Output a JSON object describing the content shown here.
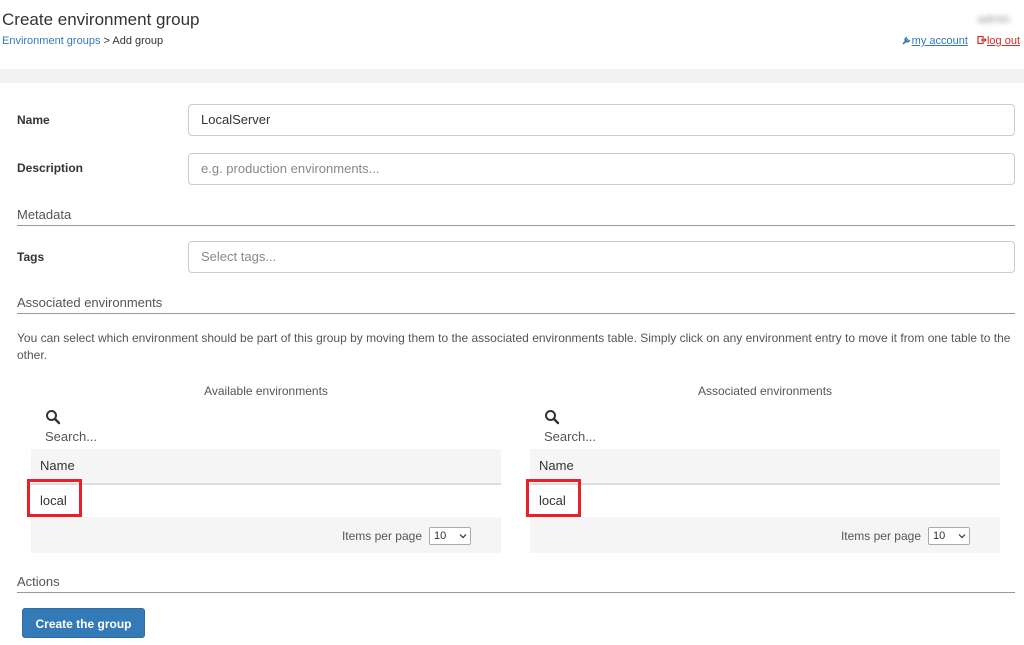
{
  "header": {
    "title": "Create environment group",
    "breadcrumb": {
      "parent": "Environment groups",
      "separator": " > ",
      "current": "Add group"
    },
    "user": {
      "name": "admin",
      "my_account": "my account",
      "log_out": "log out"
    }
  },
  "form": {
    "name": {
      "label": "Name",
      "value": "LocalServer"
    },
    "description": {
      "label": "Description",
      "placeholder": "e.g. production environments..."
    },
    "metadata_title": "Metadata",
    "tags": {
      "label": "Tags",
      "placeholder": "Select tags..."
    },
    "associated_title": "Associated environments",
    "info": "You can select which environment should be part of this group by moving them to the associated environments table. Simply click on any environment entry to move it from one table to the other."
  },
  "available": {
    "title": "Available environments",
    "search_placeholder": "Search...",
    "column": "Name",
    "rows": [
      "local"
    ],
    "items_per_page_label": "Items per page",
    "items_per_page": "10"
  },
  "associated": {
    "title": "Associated environments",
    "search_placeholder": "Search...",
    "column": "Name",
    "rows": [
      "local"
    ],
    "items_per_page_label": "Items per page",
    "items_per_page": "10"
  },
  "actions": {
    "title": "Actions",
    "create_button": "Create the group"
  },
  "colors": {
    "primary": "#337ab7",
    "logout": "#c9302c",
    "highlight": "#e8202a"
  }
}
